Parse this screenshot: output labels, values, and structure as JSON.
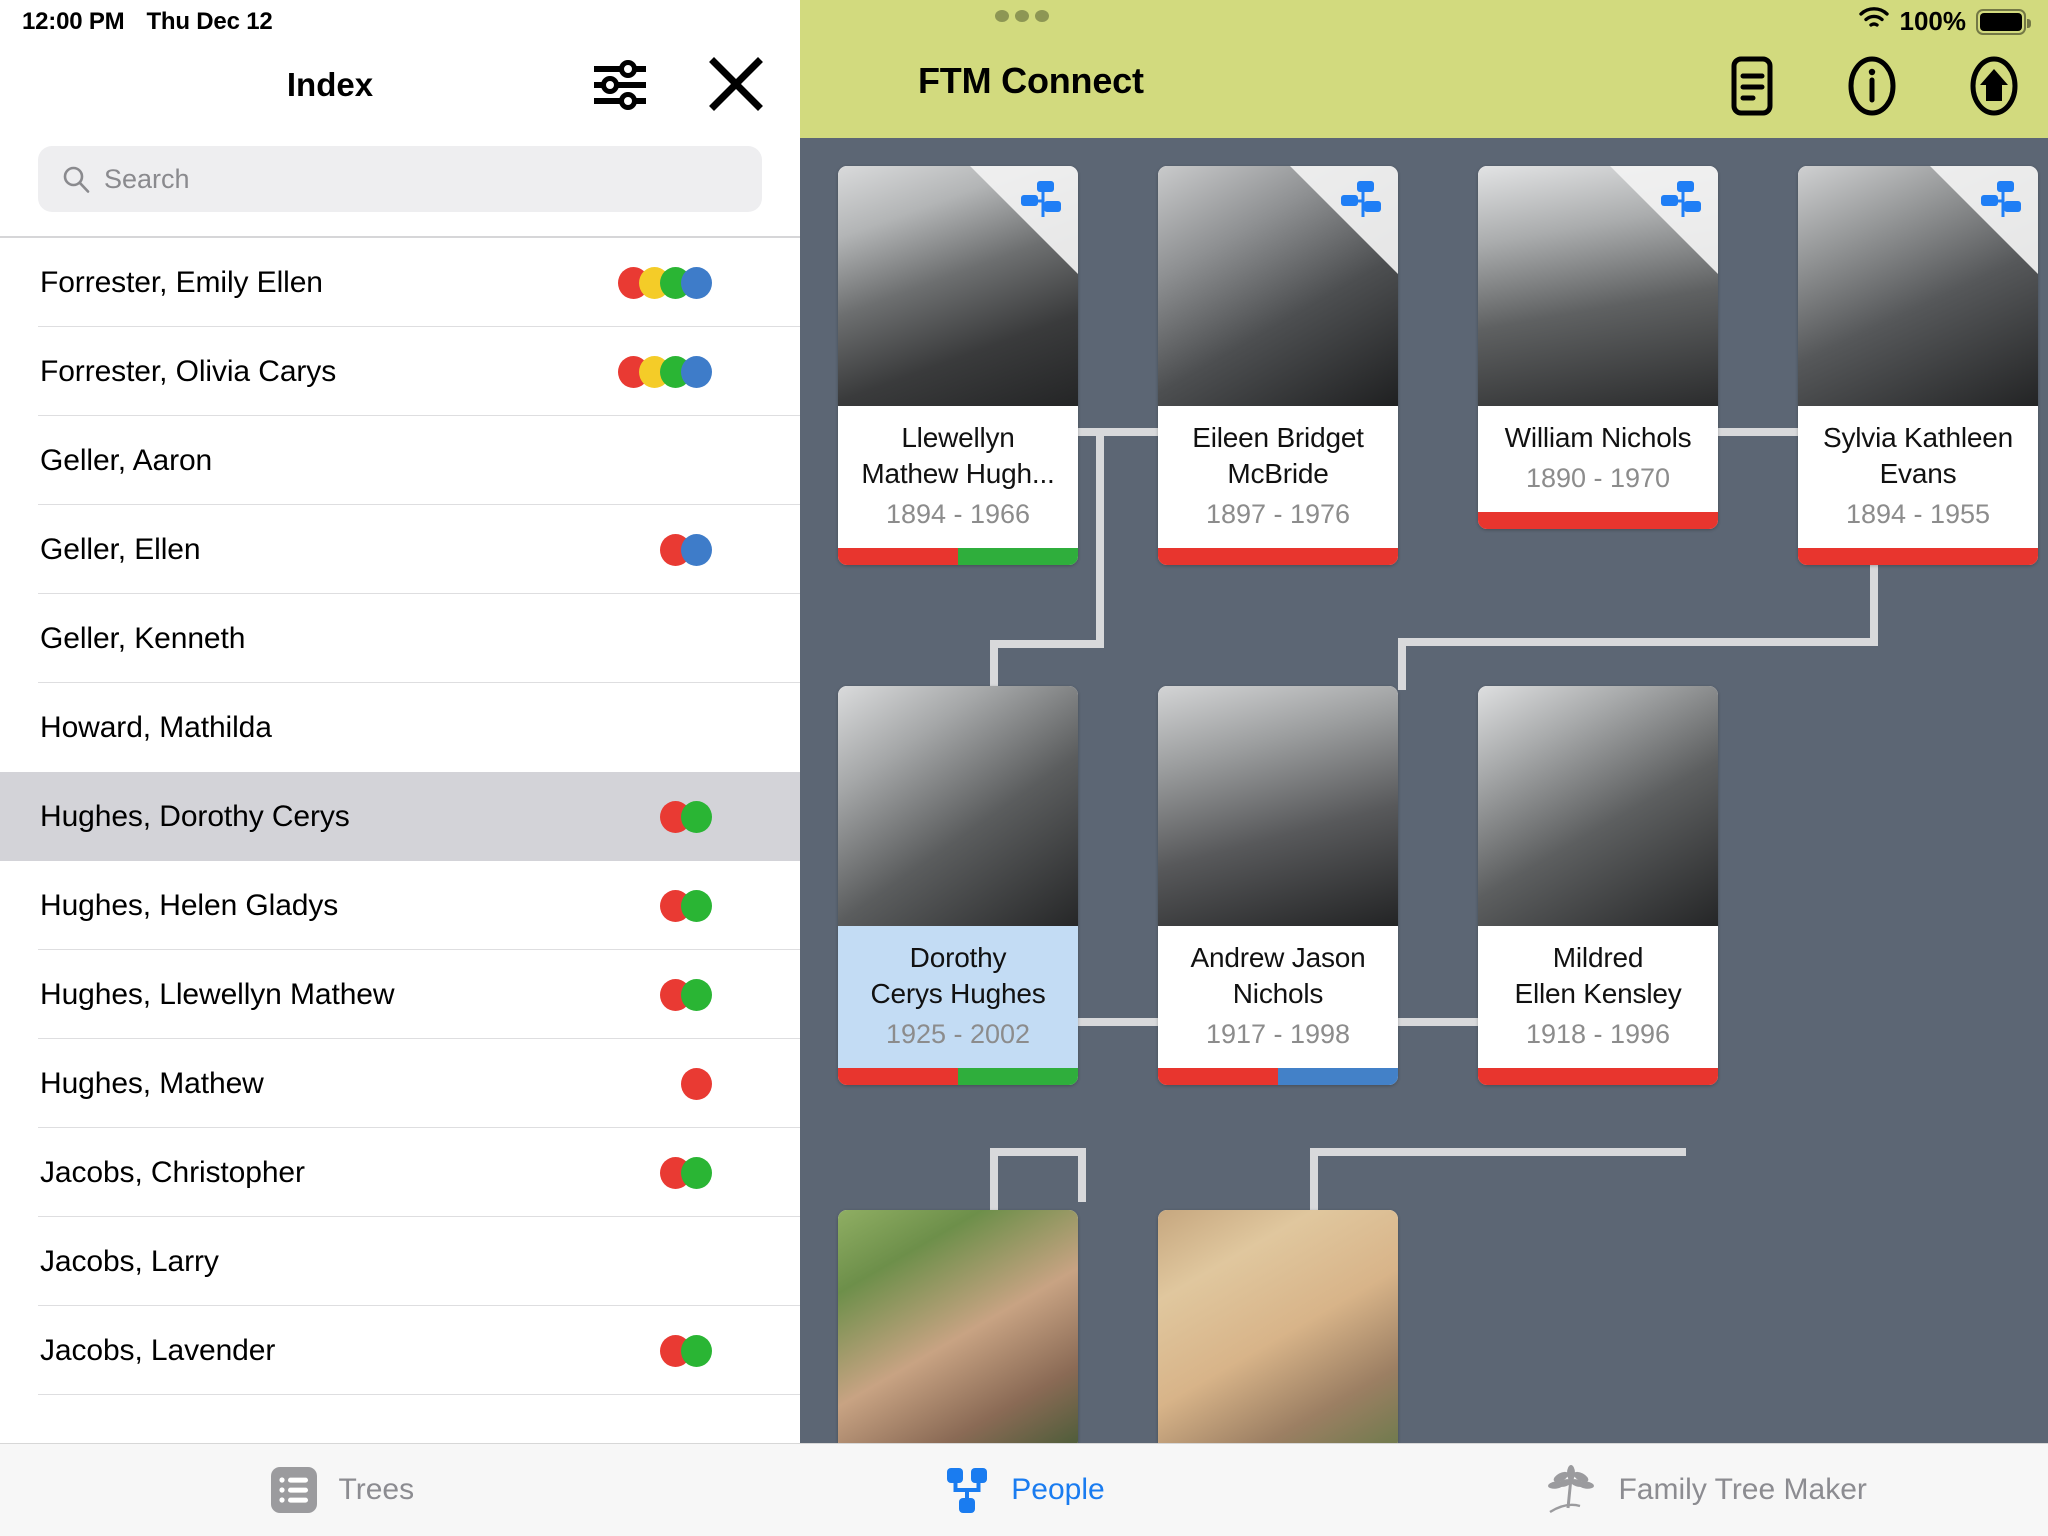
{
  "status_bar": {
    "time": "12:00 PM",
    "date": "Thu Dec 12",
    "battery_percent": "100%",
    "wifi_icon": "wifi-icon",
    "battery_icon": "battery-icon"
  },
  "index_panel": {
    "title": "Index",
    "filter_icon": "filter-sliders-icon",
    "close_icon": "close-icon",
    "search": {
      "placeholder": "Search",
      "value": "",
      "icon": "search-icon"
    },
    "colors": {
      "red": "#e93a33",
      "yellow": "#f4cc28",
      "green": "#2ab534",
      "blue": "#3e7cc9",
      "selected_row_bg": "#d3d3d8"
    },
    "rows": [
      {
        "name": "Forrester, Emily Ellen",
        "dots": [
          "red",
          "yellow",
          "green",
          "blue"
        ],
        "selected": false
      },
      {
        "name": "Forrester, Olivia Carys",
        "dots": [
          "red",
          "yellow",
          "green",
          "blue"
        ],
        "selected": false
      },
      {
        "name": "Geller, Aaron",
        "dots": [],
        "selected": false
      },
      {
        "name": "Geller, Ellen",
        "dots": [
          "red",
          "blue"
        ],
        "selected": false
      },
      {
        "name": "Geller, Kenneth",
        "dots": [],
        "selected": false
      },
      {
        "name": "Howard, Mathilda",
        "dots": [],
        "selected": false
      },
      {
        "name": "Hughes, Dorothy Cerys",
        "dots": [
          "red",
          "green"
        ],
        "selected": true
      },
      {
        "name": "Hughes, Helen Gladys",
        "dots": [
          "red",
          "green"
        ],
        "selected": false
      },
      {
        "name": "Hughes, Llewellyn Mathew",
        "dots": [
          "red",
          "green"
        ],
        "selected": false
      },
      {
        "name": "Hughes, Mathew",
        "dots": [
          "red"
        ],
        "selected": false
      },
      {
        "name": "Jacobs, Christopher",
        "dots": [
          "red",
          "green"
        ],
        "selected": false
      },
      {
        "name": "Jacobs, Larry",
        "dots": [],
        "selected": false
      },
      {
        "name": "Jacobs, Lavender",
        "dots": [
          "red",
          "green"
        ],
        "selected": false
      }
    ]
  },
  "tree_panel": {
    "header": {
      "title": "FTM Connect",
      "bg_color": "#d2da7e",
      "notes_icon": "notes-icon",
      "info_icon": "info-icon",
      "home_icon": "home-icon",
      "page_dots_icon": "page-dots-icon"
    },
    "canvas_bg": "#5c6674",
    "connector_color": "#d8d9db",
    "selected_card_bg": "#c3dcf4",
    "badge_icon": "family-tree-badge-icon",
    "cards": [
      {
        "id": "llewellyn",
        "name": "Llewellyn\nMathew Hugh...",
        "name_line1": "Llewellyn",
        "name_line2": "Mathew Hugh...",
        "dates": "1894 - 1966",
        "bar": [
          "red",
          "green"
        ],
        "badge": true,
        "selected": false,
        "photo_style": "bw-portrait-man-suit"
      },
      {
        "id": "eileen",
        "name": "Eileen Bridget McBride",
        "name_line1": "Eileen Bridget",
        "name_line2": "McBride",
        "dates": "1897 - 1976",
        "bar": [
          "red"
        ],
        "badge": true,
        "selected": false,
        "photo_style": "bw-portrait-woman-1920s"
      },
      {
        "id": "william",
        "name": "William Nichols",
        "name_line1": "William Nichols",
        "name_line2": "",
        "dates": "1890 - 1970",
        "bar": [
          "red"
        ],
        "badge": true,
        "selected": false,
        "photo_style": "bw-portrait-man-moustache"
      },
      {
        "id": "sylvia",
        "name": "Sylvia Kathleen Evans",
        "name_line1": "Sylvia Kathleen",
        "name_line2": "Evans",
        "dates": "1894 - 1955",
        "bar": [
          "red"
        ],
        "badge": true,
        "selected": false,
        "photo_style": "bw-portrait-woman-necklace"
      },
      {
        "id": "dorothy",
        "name": "Dorothy Cerys Hughes",
        "name_line1": "Dorothy",
        "name_line2": "Cerys Hughes",
        "dates": "1925 - 2002",
        "bar": [
          "red",
          "green"
        ],
        "badge": false,
        "selected": true,
        "photo_style": "bw-portrait-woman-1940s"
      },
      {
        "id": "andrew",
        "name": "Andrew Jason Nichols",
        "name_line1": "Andrew Jason",
        "name_line2": "Nichols",
        "dates": "1917 - 1998",
        "bar": [
          "red",
          "blue"
        ],
        "badge": false,
        "selected": false,
        "photo_style": "bw-portrait-man-hat"
      },
      {
        "id": "mildred",
        "name": "Mildred Ellen Kensley",
        "name_line1": "Mildred",
        "name_line2": "Ellen Kensley",
        "dates": "1918 - 1996",
        "bar": [
          "red"
        ],
        "badge": false,
        "selected": false,
        "photo_style": "bw-portrait-woman-polkadot"
      },
      {
        "id": "child1",
        "name": "",
        "name_line1": "",
        "name_line2": "",
        "dates": "",
        "bar": [],
        "badge": false,
        "selected": false,
        "photo_style": "color-photo-older-man-glasses"
      },
      {
        "id": "child2",
        "name": "",
        "name_line1": "",
        "name_line2": "",
        "dates": "",
        "bar": [],
        "badge": false,
        "selected": false,
        "photo_style": "color-photo-older-woman-blonde"
      }
    ]
  },
  "tab_bar": {
    "tabs": [
      {
        "label": "Trees",
        "icon": "trees-list-icon",
        "active": false
      },
      {
        "label": "People",
        "icon": "people-tree-icon",
        "active": true
      },
      {
        "label": "Family Tree Maker",
        "icon": "family-tree-logo-icon",
        "active": false
      }
    ],
    "active_color": "#1a7cf0",
    "inactive_color": "#8c8c91"
  }
}
